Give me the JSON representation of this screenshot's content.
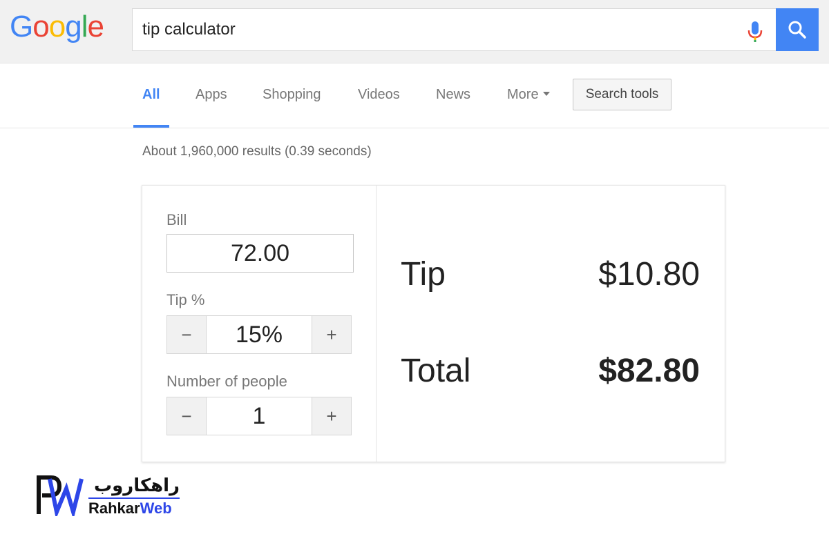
{
  "header": {
    "logo_letters": [
      {
        "ch": "G",
        "color": "#4285f4"
      },
      {
        "ch": "o",
        "color": "#ea4335"
      },
      {
        "ch": "o",
        "color": "#fbbc05"
      },
      {
        "ch": "g",
        "color": "#4285f4"
      },
      {
        "ch": "l",
        "color": "#34a853"
      },
      {
        "ch": "e",
        "color": "#ea4335"
      }
    ],
    "search_value": "tip calculator",
    "accent_color": "#4285f4"
  },
  "tabs": {
    "all": "All",
    "apps": "Apps",
    "shopping": "Shopping",
    "videos": "Videos",
    "news": "News",
    "more": "More",
    "search_tools": "Search tools"
  },
  "results_count": "About 1,960,000 results (0.39 seconds)",
  "calculator": {
    "bill_label": "Bill",
    "bill_value": "72.00",
    "tip_label": "Tip %",
    "tip_value": "15%",
    "people_label": "Number of people",
    "people_value": "1",
    "minus": "−",
    "plus": "+",
    "tip_result_label": "Tip",
    "tip_result_value": "$10.80",
    "total_label": "Total",
    "total_value": "$82.80"
  },
  "watermark": {
    "persian": "راهکاروب",
    "latin_part1": "Rahkar",
    "latin_part2": "Web",
    "logo_letters": "RW",
    "color_dark": "#111111",
    "color_blue": "#2d46e8"
  }
}
